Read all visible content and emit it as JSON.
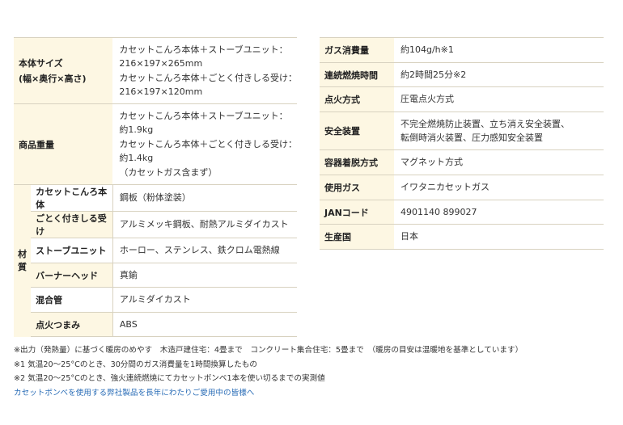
{
  "left_table": {
    "size": {
      "label_line1": "本体サイズ",
      "label_line2": "(幅×奥行×高さ)",
      "lines": [
        "カセットこんろ本体＋ストーブユニット：",
        "216×197×265mm",
        "カセットこんろ本体＋ごとく付きしる受け：",
        "216×197×120mm"
      ]
    },
    "weight": {
      "label": "商品重量",
      "lines": [
        "カセットこんろ本体＋ストーブユニット：",
        "約1.9kg",
        "カセットこんろ本体＋ごとく付きしる受け：",
        "約1.4kg",
        "（カセットガス含まず）"
      ]
    },
    "material": {
      "group_label_1": "材",
      "group_label_2": "質",
      "rows": [
        {
          "part": "カセットこんろ本体",
          "value": "鋼板（粉体塗装）"
        },
        {
          "part": "ごとく付きしる受け",
          "value": "アルミメッキ鋼板、耐熱アルミダイカスト"
        },
        {
          "part": "ストーブユニット",
          "value": "ホーロー、ステンレス、鉄クロム電熱線"
        },
        {
          "part": "バーナーヘッド",
          "value": "真鍮"
        },
        {
          "part": "混合管",
          "value": "アルミダイカスト"
        },
        {
          "part": "点火つまみ",
          "value": "ABS"
        }
      ]
    }
  },
  "right_table": [
    {
      "label": "ガス消費量",
      "lines": [
        "約104g/h※1"
      ]
    },
    {
      "label": "連続燃焼時間",
      "lines": [
        "約2時間25分※2"
      ]
    },
    {
      "label": "点火方式",
      "lines": [
        "圧電点火方式"
      ]
    },
    {
      "label": "安全装置",
      "lines": [
        "不完全燃焼防止装置、立ち消え安全装置、",
        "転倒時消火装置、圧力感知安全装置"
      ]
    },
    {
      "label": "容器着脱方式",
      "lines": [
        "マグネット方式"
      ]
    },
    {
      "label": "使用ガス",
      "lines": [
        "イワタニカセットガス"
      ]
    },
    {
      "label": "JANコード",
      "lines": [
        "4901140 899027"
      ]
    },
    {
      "label": "生産国",
      "lines": [
        "日本"
      ]
    }
  ],
  "notes": {
    "note1": "※出力（発熱量）に基づく暖房のめやす　木造戸建住宅：4畳まで　コンクリート集合住宅：5畳まで　（暖房の目安は温暖地を基準としています）",
    "note2": "※1 気温20〜25°Cのとき、30分間のガス消費量を1時間換算したもの",
    "note3": "※2 気温20〜25°Cのとき、強火連続燃焼にてカセットボンベ1本を使い切るまでの実測値",
    "link": "カセットボンベを使用する弊社製品を長年にわたりご愛用中の皆様へ"
  },
  "colors": {
    "label_bg": "#fdf7e3",
    "border": "#d8d2c0",
    "link": "#2a6db7"
  }
}
